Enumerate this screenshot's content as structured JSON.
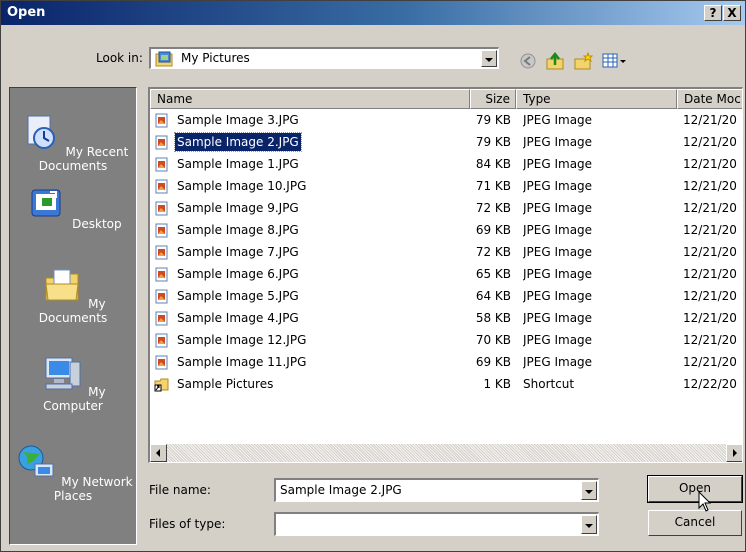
{
  "window": {
    "title": "Open",
    "help_label": "?",
    "close_label": "X"
  },
  "toolbar": {
    "lookin_label": "Look in:",
    "lookin_value": "My Pictures",
    "icons": [
      "back-icon",
      "up-folder-icon",
      "new-folder-icon",
      "views-menu-icon"
    ]
  },
  "places": [
    {
      "label": "My Recent Documents",
      "icon": "recent-documents-icon"
    },
    {
      "label": "Desktop",
      "icon": "desktop-icon"
    },
    {
      "label": "My Documents",
      "icon": "my-documents-icon"
    },
    {
      "label": "My Computer",
      "icon": "my-computer-icon"
    },
    {
      "label": "My Network Places",
      "icon": "network-places-icon"
    }
  ],
  "filelist": {
    "columns": {
      "name": "Name",
      "size": "Size",
      "type": "Type",
      "date": "Date Moc"
    },
    "rows": [
      {
        "name": "Sample Image 3.JPG",
        "size": "79 KB",
        "type": "JPEG Image",
        "date": "12/21/20",
        "icon": "jpeg-file-icon"
      },
      {
        "name": "Sample Image 2.JPG",
        "size": "79 KB",
        "type": "JPEG Image",
        "date": "12/21/20",
        "icon": "jpeg-file-icon",
        "selected": true
      },
      {
        "name": "Sample Image 1.JPG",
        "size": "84 KB",
        "type": "JPEG Image",
        "date": "12/21/20",
        "icon": "jpeg-file-icon"
      },
      {
        "name": "Sample Image 10.JPG",
        "size": "71 KB",
        "type": "JPEG Image",
        "date": "12/21/20",
        "icon": "jpeg-file-icon"
      },
      {
        "name": "Sample Image 9.JPG",
        "size": "72 KB",
        "type": "JPEG Image",
        "date": "12/21/20",
        "icon": "jpeg-file-icon"
      },
      {
        "name": "Sample Image 8.JPG",
        "size": "69 KB",
        "type": "JPEG Image",
        "date": "12/21/20",
        "icon": "jpeg-file-icon"
      },
      {
        "name": "Sample Image 7.JPG",
        "size": "72 KB",
        "type": "JPEG Image",
        "date": "12/21/20",
        "icon": "jpeg-file-icon"
      },
      {
        "name": "Sample Image 6.JPG",
        "size": "65 KB",
        "type": "JPEG Image",
        "date": "12/21/20",
        "icon": "jpeg-file-icon"
      },
      {
        "name": "Sample Image 5.JPG",
        "size": "64 KB",
        "type": "JPEG Image",
        "date": "12/21/20",
        "icon": "jpeg-file-icon"
      },
      {
        "name": "Sample Image 4.JPG",
        "size": "58 KB",
        "type": "JPEG Image",
        "date": "12/21/20",
        "icon": "jpeg-file-icon"
      },
      {
        "name": "Sample Image 12.JPG",
        "size": "70 KB",
        "type": "JPEG Image",
        "date": "12/21/20",
        "icon": "jpeg-file-icon"
      },
      {
        "name": "Sample Image 11.JPG",
        "size": "69 KB",
        "type": "JPEG Image",
        "date": "12/21/20",
        "icon": "jpeg-file-icon"
      },
      {
        "name": "Sample Pictures",
        "size": "1 KB",
        "type": "Shortcut",
        "date": "12/22/20",
        "icon": "folder-shortcut-icon"
      }
    ]
  },
  "form": {
    "filename_label": "File name:",
    "filename_value": "Sample Image 2.JPG",
    "filetype_label": "Files of type:",
    "filetype_value": ""
  },
  "buttons": {
    "open": "Open",
    "cancel": "Cancel"
  }
}
